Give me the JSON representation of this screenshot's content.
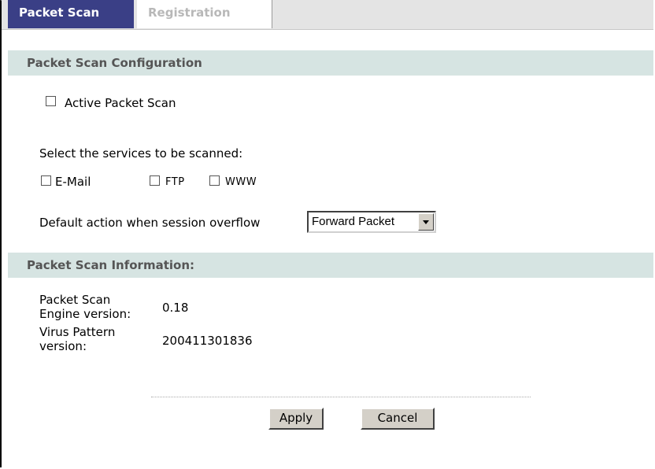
{
  "tabs": [
    {
      "label": "Packet Scan",
      "active": true
    },
    {
      "label": "Registration",
      "active": false
    }
  ],
  "config": {
    "header": "Packet Scan Configuration",
    "active_label": "Active Packet Scan",
    "active_checked": false,
    "services_prompt": "Select the services to be scanned:",
    "services": [
      {
        "label": "E-Mail",
        "checked": false
      },
      {
        "label": "FTP",
        "checked": false
      },
      {
        "label": "WWW",
        "checked": false
      }
    ],
    "overflow_label": "Default action when session overflow",
    "overflow_value": "Forward Packet"
  },
  "info": {
    "header": "Packet Scan Information:",
    "engine_label_1": "Packet Scan",
    "engine_label_2": "Engine version:",
    "engine_value": "0.18",
    "pattern_label_1": "Virus Pattern",
    "pattern_label_2": "version:",
    "pattern_value": "200411301836"
  },
  "buttons": {
    "apply": "Apply",
    "cancel": "Cancel"
  }
}
